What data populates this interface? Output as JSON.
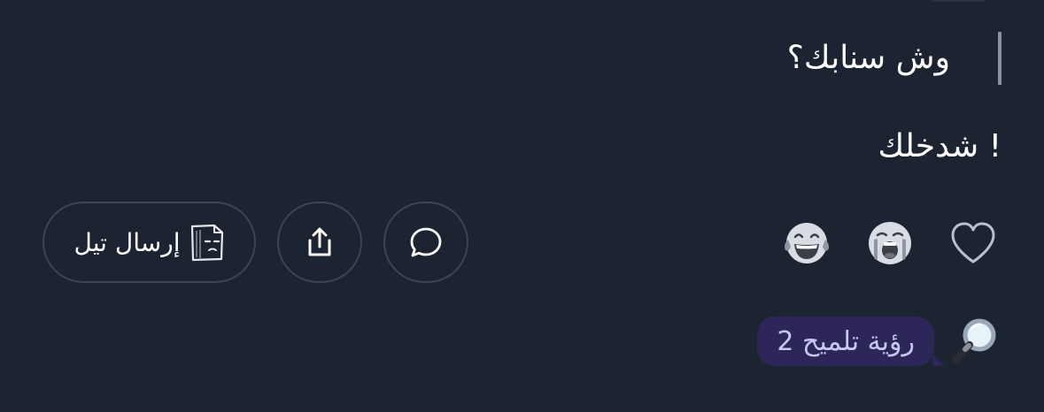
{
  "question": {
    "text": "وش سنابك؟"
  },
  "answer": {
    "text": "! شدخلك"
  },
  "reactions": [
    {
      "icon": "heart-outline-icon"
    },
    {
      "icon": "crying-face-icon"
    },
    {
      "icon": "laughing-tears-face-icon"
    }
  ],
  "actions": {
    "reply_icon": "chat-bubble-icon",
    "share_icon": "share-upload-icon",
    "send_label": "إرسال تيل",
    "send_icon": "paper-bag-face-icon"
  },
  "hint": {
    "label": "رؤية تلميح 2",
    "icon": "magnifying-glass-icon",
    "pill_color": "#2c2758"
  },
  "colors": {
    "background": "#1c2331",
    "button_border": "#3a4558",
    "hint_text": "#c9c6f1"
  }
}
